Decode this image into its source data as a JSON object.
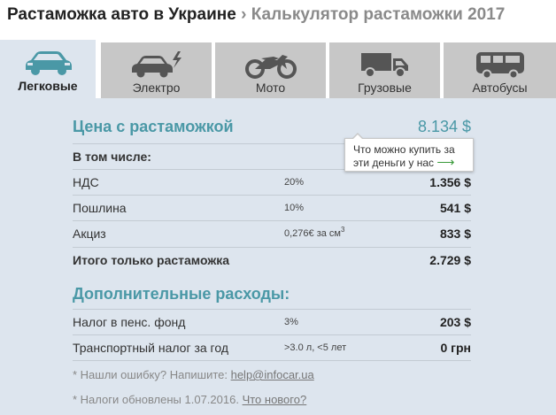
{
  "header": {
    "main_title": "Растаможка авто в Украине",
    "separator": "›",
    "sub_title": "Калькулятор растаможки 2017"
  },
  "tabs": [
    {
      "label": "Легковые",
      "icon": "car-icon",
      "active": true
    },
    {
      "label": "Электро",
      "icon": "electric-car-icon",
      "active": false
    },
    {
      "label": "Мото",
      "icon": "motorcycle-icon",
      "active": false
    },
    {
      "label": "Грузовые",
      "icon": "truck-icon",
      "active": false
    },
    {
      "label": "Автобусы",
      "icon": "bus-icon",
      "active": false
    }
  ],
  "price": {
    "label": "Цена с растаможкой",
    "value": "8.134 $"
  },
  "tooltip": {
    "text_line1": "Что можно купить за",
    "text_line2": "эти деньги у нас",
    "arrow": "⟶"
  },
  "breakdown": {
    "heading": "В том числе:",
    "rows": [
      {
        "label": "НДС",
        "rate": "20%",
        "rate_sup": "",
        "value": "1.356 $"
      },
      {
        "label": "Пошлина",
        "rate": "10%",
        "rate_sup": "",
        "value": "541 $"
      },
      {
        "label": "Акциз",
        "rate": "0,276€ за см",
        "rate_sup": "3",
        "value": "833 $"
      }
    ],
    "total_label": "Итого только растаможка",
    "total_value": "2.729 $"
  },
  "extra": {
    "label": "Дополнительные расходы:",
    "rows": [
      {
        "label": "Налог в пенс. фонд",
        "rate": "3%",
        "value": "203 $"
      },
      {
        "label": "Транспортный налог за год",
        "rate": ">3.0 л, <5 лет",
        "value": "0 грн"
      }
    ]
  },
  "notes": {
    "error_text": "* Нашли ошибку? Напишите: ",
    "error_email": "help@infocar.ua",
    "update_text": "* Налоги обновлены 1.07.2016. ",
    "update_link": "Что нового?"
  },
  "colors": {
    "accent": "#4a98a6",
    "panel_bg": "#dde5ee",
    "tab_inactive": "#c7c7c7",
    "icon_active": "#4a98a6",
    "icon_inactive": "#555555",
    "tooltip_arrow": "#3a9a3a"
  }
}
